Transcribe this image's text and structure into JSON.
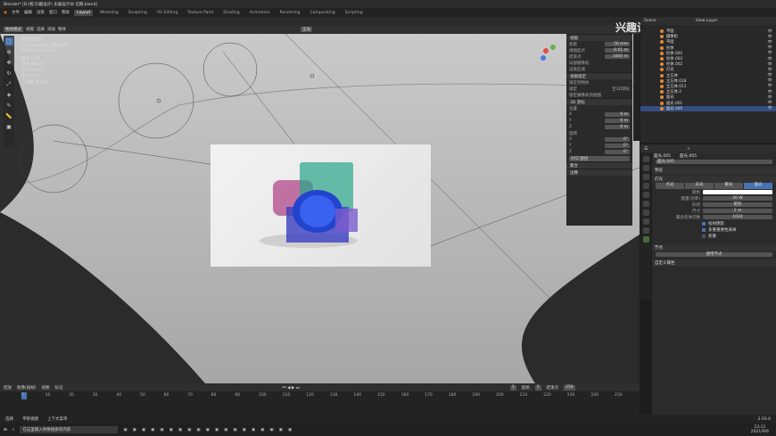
{
  "titlebar": {
    "text": "Blender* [D:\\练习\\酷设计\\ 乐器设计\\B 已稿.blend]"
  },
  "menubar": {
    "menus": [
      "文件",
      "编辑",
      "渲染",
      "窗口",
      "帮助"
    ],
    "workspaces": [
      "Layout",
      "Modeling",
      "Sculpting",
      "UV Editing",
      "Texture Paint",
      "Shading",
      "Animation",
      "Rendering",
      "Compositing",
      "Scripting"
    ],
    "active_workspace": "Layout"
  },
  "viewport_header": {
    "mode": "物体模式",
    "view": "视图",
    "select": "选择",
    "add": "添加",
    "object": "物体",
    "transform": "全局"
  },
  "stats": {
    "camera": "摄像机透视",
    "collection": "(1) Collection | 面光 001",
    "status": "Rendering Done",
    "rows": [
      [
        "物体",
        "1/29"
      ],
      [
        "顶点",
        "38,537"
      ],
      [
        "边",
        "39,300"
      ],
      [
        "面",
        "18,316"
      ],
      [
        "三角面",
        "38,122"
      ]
    ]
  },
  "npanel": {
    "view_section": "视图",
    "focal": "焦距",
    "focal_val": "50 mm",
    "clip_start": "视图起点",
    "clip_start_val": "0.01 m",
    "clip_end": "结束点",
    "clip_end_val": "1000 m",
    "local_cam": "局部摄像机",
    "render_region": "渲染区域",
    "lock_section": "视图锁定",
    "lock_to": "锁定到物体",
    "lock": "锁定",
    "lock_cursor": "至3D游标",
    "lock_camera": "锁定摄像机到视图",
    "cursor_section": "3D 游标",
    "location": "位置",
    "x": "X",
    "y": "Y",
    "z": "Z",
    "x_val": "0 m",
    "y_val": "0 m",
    "z_val": "0 m",
    "rotation": "旋转",
    "rx": "0°",
    "ry": "0°",
    "rz": "0°",
    "rot_mode": "XYZ 欧拉",
    "collections": "集合",
    "annotations": "注释"
  },
  "outliner": {
    "scene": "Scene",
    "view_layer": "View Layer",
    "rows": [
      "平面",
      "摄像机",
      "平面",
      "柱体",
      "柱体.002",
      "柱体.003",
      "柱体.002",
      "灯光",
      "立方体",
      "立方体.018",
      "立方体.011",
      "立方体.2",
      "面光",
      "面光.001",
      "面光 005"
    ],
    "selected_index": 14
  },
  "props": {
    "object_name": "面光.005",
    "data_name": "面光.005",
    "preview": "预览",
    "light": "灯光",
    "types": [
      "点光",
      "日光",
      "聚光",
      "面光"
    ],
    "active_type": 3,
    "color_label": "颜色",
    "power_label": "能量(功率)",
    "power_val": "20 W",
    "shape_label": "形状",
    "shape_val": "矩形",
    "size_label": "尺寸",
    "size_val": "1 m",
    "max_bounce_label": "最多反弹次数",
    "max_bounce_val": "1024",
    "cast_shadow": "投射阴影",
    "multi_importance": "多重重要性采样",
    "shadow_catcher": "焦散",
    "nodes": "节点",
    "use_nodes": "使用节点",
    "custom_props": "自定义属性"
  },
  "timeline": {
    "playback": "回放",
    "keying": "抠像(插帧)",
    "view": "视图",
    "marker": "标记",
    "frame": "1",
    "start_label": "起始",
    "start": "1",
    "end_label": "结束点",
    "end": "250",
    "ticks": [
      "0",
      "10",
      "20",
      "30",
      "40",
      "50",
      "60",
      "70",
      "80",
      "90",
      "100",
      "110",
      "120",
      "130",
      "140",
      "150",
      "160",
      "170",
      "180",
      "190",
      "200",
      "210",
      "220",
      "230",
      "240",
      "250"
    ]
  },
  "statusbar": {
    "select": "选择",
    "pan": "平移视图",
    "menu": "上下文菜单",
    "version": "2.93.0"
  },
  "taskbar": {
    "search": "在这里输入你要搜索的内容",
    "time": "23:11",
    "date": "2021/9/6"
  },
  "watermark": "兴趣设计师k bilibili",
  "colors": {
    "accent": "#4772b3",
    "selected": "#334d80",
    "light_orange": "#e08a3a"
  }
}
